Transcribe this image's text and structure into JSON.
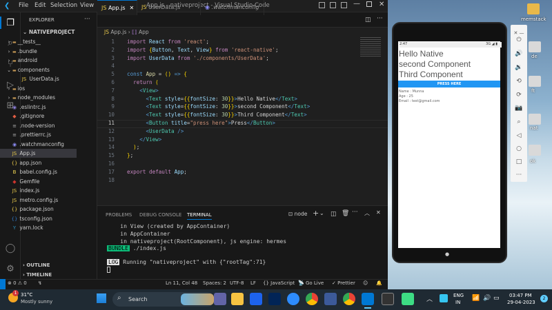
{
  "window": {
    "title": "App.js - nativeproject - Visual Studio Code",
    "menu": [
      "File",
      "Edit",
      "Selection",
      "View",
      "Go",
      "···"
    ]
  },
  "sidebar": {
    "header": "EXPLORER",
    "project": "NATIVEPROJECT",
    "items": [
      {
        "label": "__tests__",
        "type": "folder",
        "open": false
      },
      {
        "label": ".bundle",
        "type": "folder",
        "open": false
      },
      {
        "label": "android",
        "type": "folder",
        "open": false
      },
      {
        "label": "components",
        "type": "folder",
        "open": true
      },
      {
        "label": "UserData.js",
        "type": "js",
        "indent": 2
      },
      {
        "label": "ios",
        "type": "folder",
        "open": false
      },
      {
        "label": "node_modules",
        "type": "folder",
        "open": false
      },
      {
        "label": ".eslintrc.js",
        "type": "eslint"
      },
      {
        "label": ".gitignore",
        "type": "git"
      },
      {
        "label": ".node-version",
        "type": "file"
      },
      {
        "label": ".prettierrc.js",
        "type": "file"
      },
      {
        "label": ".watchmanconfig",
        "type": "watch"
      },
      {
        "label": "App.js",
        "type": "js",
        "selected": true
      },
      {
        "label": "app.json",
        "type": "json"
      },
      {
        "label": "babel.config.js",
        "type": "babel"
      },
      {
        "label": "Gemfile",
        "type": "gem"
      },
      {
        "label": "index.js",
        "type": "js"
      },
      {
        "label": "metro.config.js",
        "type": "js"
      },
      {
        "label": "package.json",
        "type": "json"
      },
      {
        "label": "tsconfig.json",
        "type": "ts"
      },
      {
        "label": "yarn.lock",
        "type": "yarn"
      }
    ],
    "outline": "OUTLINE",
    "timeline": "TIMELINE"
  },
  "tabs": [
    {
      "label": "App.js",
      "active": true
    },
    {
      "label": "UserData.js",
      "active": false
    },
    {
      "label": ".watchmanconfig",
      "active": false
    }
  ],
  "breadcrumb": {
    "file": "App.js",
    "symbol": "App"
  },
  "code": [
    [
      [
        "kw",
        "import "
      ],
      [
        "v",
        "React "
      ],
      [
        "kw",
        "from "
      ],
      [
        "s",
        "'react'"
      ],
      [
        "tx",
        ";"
      ]
    ],
    [
      [
        "kw",
        "import "
      ],
      [
        "p",
        "{"
      ],
      [
        "v",
        "Button"
      ],
      [
        "tx",
        ", "
      ],
      [
        "v",
        "Text"
      ],
      [
        "tx",
        ", "
      ],
      [
        "v",
        "View"
      ],
      [
        "p",
        "}"
      ],
      [
        "kw",
        " from "
      ],
      [
        "s",
        "'react-native'"
      ],
      [
        "tx",
        ";"
      ]
    ],
    [
      [
        "kw",
        "import "
      ],
      [
        "v",
        "UserData "
      ],
      [
        "kw",
        "from "
      ],
      [
        "s",
        "'./components/UserData'"
      ],
      [
        "tx",
        ";"
      ]
    ],
    [],
    [
      [
        "t",
        "const "
      ],
      [
        "f",
        "App "
      ],
      [
        "tx",
        "= "
      ],
      [
        "p",
        "() "
      ],
      [
        "t",
        "=> "
      ],
      [
        "p",
        "{"
      ]
    ],
    [
      [
        "tx",
        "  "
      ],
      [
        "kw",
        "return "
      ],
      [
        "p",
        "("
      ]
    ],
    [
      [
        "tx",
        "    "
      ],
      [
        "t",
        "<"
      ],
      [
        "tg",
        "View"
      ],
      [
        "t",
        ">"
      ]
    ],
    [
      [
        "tx",
        "      "
      ],
      [
        "t",
        "<"
      ],
      [
        "tg",
        "Text "
      ],
      [
        "v",
        "style"
      ],
      [
        "tx",
        "="
      ],
      [
        "p",
        "{{"
      ],
      [
        "v",
        "fontSize"
      ],
      [
        "tx",
        ": "
      ],
      [
        "n",
        "30"
      ],
      [
        "p",
        "}}"
      ],
      [
        "t",
        ">"
      ],
      [
        "tx",
        "Hello Native"
      ],
      [
        "t",
        "</"
      ],
      [
        "tg",
        "Text"
      ],
      [
        "t",
        ">"
      ]
    ],
    [
      [
        "tx",
        "      "
      ],
      [
        "t",
        "<"
      ],
      [
        "tg",
        "Text "
      ],
      [
        "v",
        "style"
      ],
      [
        "tx",
        "="
      ],
      [
        "p",
        "{{"
      ],
      [
        "v",
        "fontSize"
      ],
      [
        "tx",
        ": "
      ],
      [
        "n",
        "30"
      ],
      [
        "p",
        "}}"
      ],
      [
        "t",
        ">"
      ],
      [
        "tx",
        "second Component"
      ],
      [
        "t",
        "</"
      ],
      [
        "tg",
        "Text"
      ],
      [
        "t",
        ">"
      ]
    ],
    [
      [
        "tx",
        "      "
      ],
      [
        "t",
        "<"
      ],
      [
        "tg",
        "Text "
      ],
      [
        "v",
        "style"
      ],
      [
        "tx",
        "="
      ],
      [
        "p",
        "{{"
      ],
      [
        "v",
        "fontSize"
      ],
      [
        "tx",
        ": "
      ],
      [
        "n",
        "30"
      ],
      [
        "p",
        "}}"
      ],
      [
        "t",
        ">"
      ],
      [
        "tx",
        "Third Component"
      ],
      [
        "t",
        "</"
      ],
      [
        "tg",
        "Text"
      ],
      [
        "t",
        ">"
      ]
    ],
    [
      [
        "tx",
        "      "
      ],
      [
        "t",
        "<"
      ],
      [
        "tg",
        "Button "
      ],
      [
        "v",
        "title"
      ],
      [
        "tx",
        "="
      ],
      [
        "s",
        "\"press here\""
      ],
      [
        "t",
        ">"
      ],
      [
        "tx",
        "Press"
      ],
      [
        "t",
        "</"
      ],
      [
        "tg",
        "Button"
      ],
      [
        "t",
        ">"
      ]
    ],
    [
      [
        "tx",
        "      "
      ],
      [
        "t",
        "<"
      ],
      [
        "tg",
        "UserData "
      ],
      [
        "t",
        "/>"
      ]
    ],
    [
      [
        "tx",
        "    "
      ],
      [
        "t",
        "</"
      ],
      [
        "tg",
        "View"
      ],
      [
        "t",
        ">"
      ]
    ],
    [
      [
        "tx",
        "  "
      ],
      [
        "p",
        ")"
      ],
      [
        "tx",
        ";"
      ]
    ],
    [
      [
        "p",
        "}"
      ],
      [
        "tx",
        ";"
      ]
    ],
    [],
    [
      [
        "kw",
        "export default "
      ],
      [
        "v",
        "App"
      ],
      [
        "tx",
        ";"
      ]
    ],
    []
  ],
  "panel": {
    "tabs": [
      "PROBLEMS",
      "DEBUG CONSOLE",
      "TERMINAL"
    ],
    "active": "TERMINAL",
    "shell": "node",
    "lines": [
      "    in View (created by AppContainer)",
      "    in AppContainer",
      "    in nativeproject(RootComponent), js engine: hermes"
    ],
    "bundle_tag": "BUNDLE",
    "bundle_text": " ./index.js",
    "log_tag": "LOG",
    "log_text": " Running \"nativeproject\" with {\"rootTag\":71}"
  },
  "status": {
    "errors": "⊗ 0 ⚠ 0",
    "position": "Ln 11, Col 48",
    "spaces": "Spaces: 2",
    "encoding": "UTF-8",
    "eol": "LF",
    "language": "{} JavaScript",
    "golive": "Go Live",
    "prettier": "✓ Prettier"
  },
  "phone": {
    "time": "2:47",
    "status_right": "3G ◢ ▮",
    "texts": [
      "Hello Native",
      "second Component",
      "Third Component"
    ],
    "button": "PRESS HERE",
    "info": [
      "Name : Munna",
      "Age : 25",
      "Email : test@gmail.com"
    ]
  },
  "desktop": {
    "labels": [
      "memstack",
      "de",
      "ft",
      "nat",
      "ok"
    ]
  },
  "taskbar": {
    "weather_temp": "31°C",
    "weather_desc": "Mostly sunny",
    "search": "Search",
    "lang1": "ENG",
    "lang2": "IN",
    "time": "03:47 PM",
    "date": "29-04-2023",
    "notif": "1",
    "badge": "2"
  },
  "colors": {
    "accent": "#0078d4",
    "button_blue": "#2196f3",
    "bundle_green": "#0dbc79",
    "status_bg": "#181818"
  }
}
